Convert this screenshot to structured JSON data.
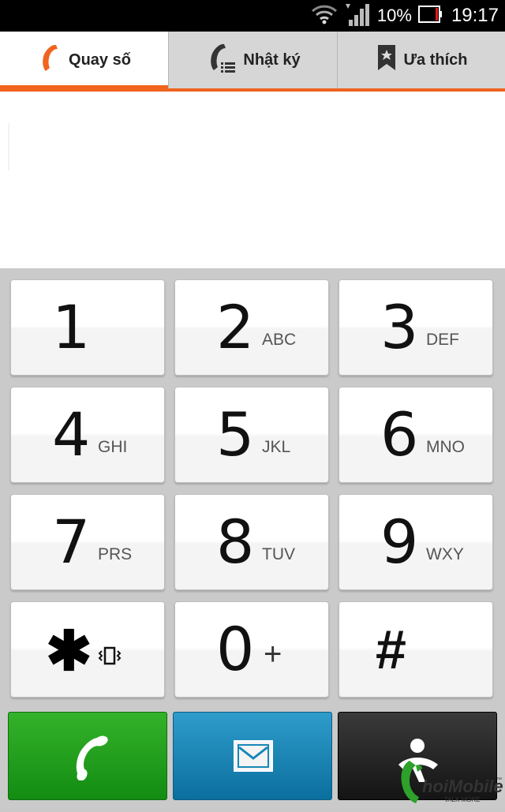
{
  "status": {
    "battery_percent": "10%",
    "time": "19:17"
  },
  "tabs": [
    {
      "label": "Quay số",
      "icon": "phone-icon",
      "active": true
    },
    {
      "label": "Nhật ký",
      "icon": "call-log-icon",
      "active": false
    },
    {
      "label": "Ưa thích",
      "icon": "bookmark-star-icon",
      "active": false
    }
  ],
  "keypad": {
    "keys": [
      {
        "digit": "1",
        "letters": ""
      },
      {
        "digit": "2",
        "letters": "ABC"
      },
      {
        "digit": "3",
        "letters": "DEF"
      },
      {
        "digit": "4",
        "letters": "GHI"
      },
      {
        "digit": "5",
        "letters": "JKL"
      },
      {
        "digit": "6",
        "letters": "MNO"
      },
      {
        "digit": "7",
        "letters": "PRS"
      },
      {
        "digit": "8",
        "letters": "TUV"
      },
      {
        "digit": "9",
        "letters": "WXY"
      },
      {
        "digit": "✱",
        "letters": ""
      },
      {
        "digit": "0",
        "letters": "+"
      },
      {
        "digit": "#",
        "letters": ""
      }
    ]
  },
  "actions": [
    {
      "name": "call-button",
      "icon": "phone-icon",
      "color": "#1e9e1a"
    },
    {
      "name": "message-button",
      "icon": "envelope-icon",
      "color": "#1787b8"
    },
    {
      "name": "ussd-button",
      "icon": "person-phone-icon",
      "color": "#222222"
    }
  ],
  "watermark": {
    "brand": "hoiMobile",
    "tagline": "TALK MORE",
    "tm": "™"
  }
}
